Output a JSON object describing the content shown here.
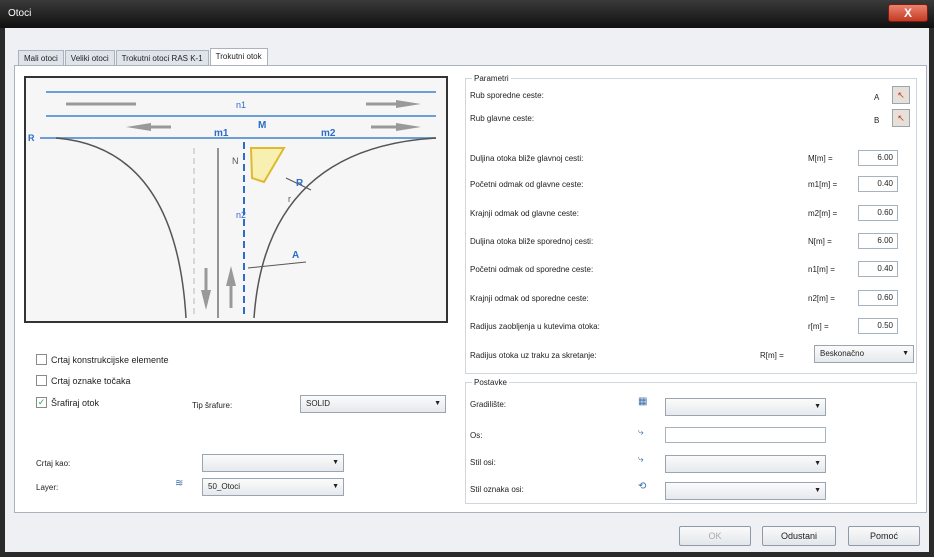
{
  "window": {
    "title": "Otoci",
    "close": "X"
  },
  "tabs": [
    "Mali otoci",
    "Veliki otoci",
    "Trokutni otoci RAS K-1",
    "Trokutni otok"
  ],
  "diagram": {
    "labels": {
      "R": "R",
      "n1": "n1",
      "m1": "m1",
      "M": "M",
      "m2": "m2",
      "N": "N",
      "r": "r",
      "n2": "n2",
      "A": "A",
      "Rc": "R"
    }
  },
  "left": {
    "chk_construct": {
      "label": "Crtaj konstrukcijske elemente",
      "checked": false
    },
    "chk_points": {
      "label": "Crtaj oznake točaka",
      "checked": false
    },
    "chk_hatch": {
      "label": "Šrafiraj otok",
      "checked": true
    },
    "hatch_type_label": "Tip šrafure:",
    "hatch_type_value": "SOLID",
    "draw_as_label": "Crtaj kao:",
    "draw_as_value": "",
    "layer_label": "Layer:",
    "layer_value": "50_Otoci"
  },
  "params": {
    "legend": "Parametri",
    "rub_sporedne": {
      "label": "Rub sporedne ceste:",
      "sym": "A"
    },
    "rub_glavne": {
      "label": "Rub glavne ceste:",
      "sym": "B"
    },
    "rows": [
      {
        "label": "Duljina otoka bliže glavnoj cesti:",
        "sym": "M[m] =",
        "value": "6.00"
      },
      {
        "label": "Početni odmak od glavne ceste:",
        "sym": "m1[m] =",
        "value": "0.40"
      },
      {
        "label": "Krajnji odmak od glavne ceste:",
        "sym": "m2[m] =",
        "value": "0.60"
      },
      {
        "label": "Duljina otoka bliže sporednoj cesti:",
        "sym": "N[m] =",
        "value": "6.00"
      },
      {
        "label": "Početni odmak od sporedne ceste:",
        "sym": "n1[m] =",
        "value": "0.40"
      },
      {
        "label": "Krajnji odmak od sporedne ceste:",
        "sym": "n2[m] =",
        "value": "0.60"
      },
      {
        "label": "Radijus zaobljenja u kutevima otoka:",
        "sym": "r[m] =",
        "value": "0.50"
      }
    ],
    "radius_lane": {
      "label": "Radijus otoka uz traku za skretanje:",
      "sym": "R[m] =",
      "value": "Beskonačno"
    }
  },
  "settings": {
    "legend": "Postavke",
    "gradiliste": {
      "label": "Gradilište:",
      "value": ""
    },
    "os": {
      "label": "Os:",
      "value": ""
    },
    "stil_osi": {
      "label": "Stil osi:",
      "value": ""
    },
    "stil_oznaka": {
      "label": "Stil oznaka osi:",
      "value": ""
    }
  },
  "buttons": {
    "ok": "OK",
    "cancel": "Odustani",
    "help": "Pomoć"
  }
}
